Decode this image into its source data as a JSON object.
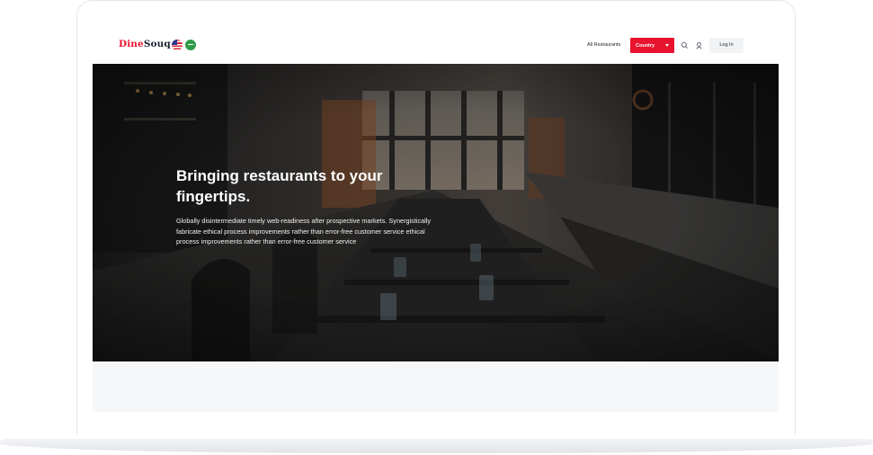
{
  "brand": {
    "name_part1": "Dine",
    "name_part2": "Souq"
  },
  "header": {
    "flags": [
      "us-flag-icon",
      "saudi-flag-icon"
    ],
    "nav_link": "All Restaurants",
    "country_button": "Country",
    "icons": [
      "search-icon",
      "user-icon"
    ],
    "login_label": "Log In"
  },
  "hero": {
    "title": "Bringing restaurants to your fingertips.",
    "description": "Globally disintermediate timely web-readiness after prospective markets. Synergistically fabricate ethical process improvements rather than error-free customer service  ethical process improvements rather than error-free customer service"
  },
  "colors": {
    "brand_red": "#e8132f",
    "brand_dark": "#1f2333",
    "hero_overlay": "#2a2b2d"
  }
}
